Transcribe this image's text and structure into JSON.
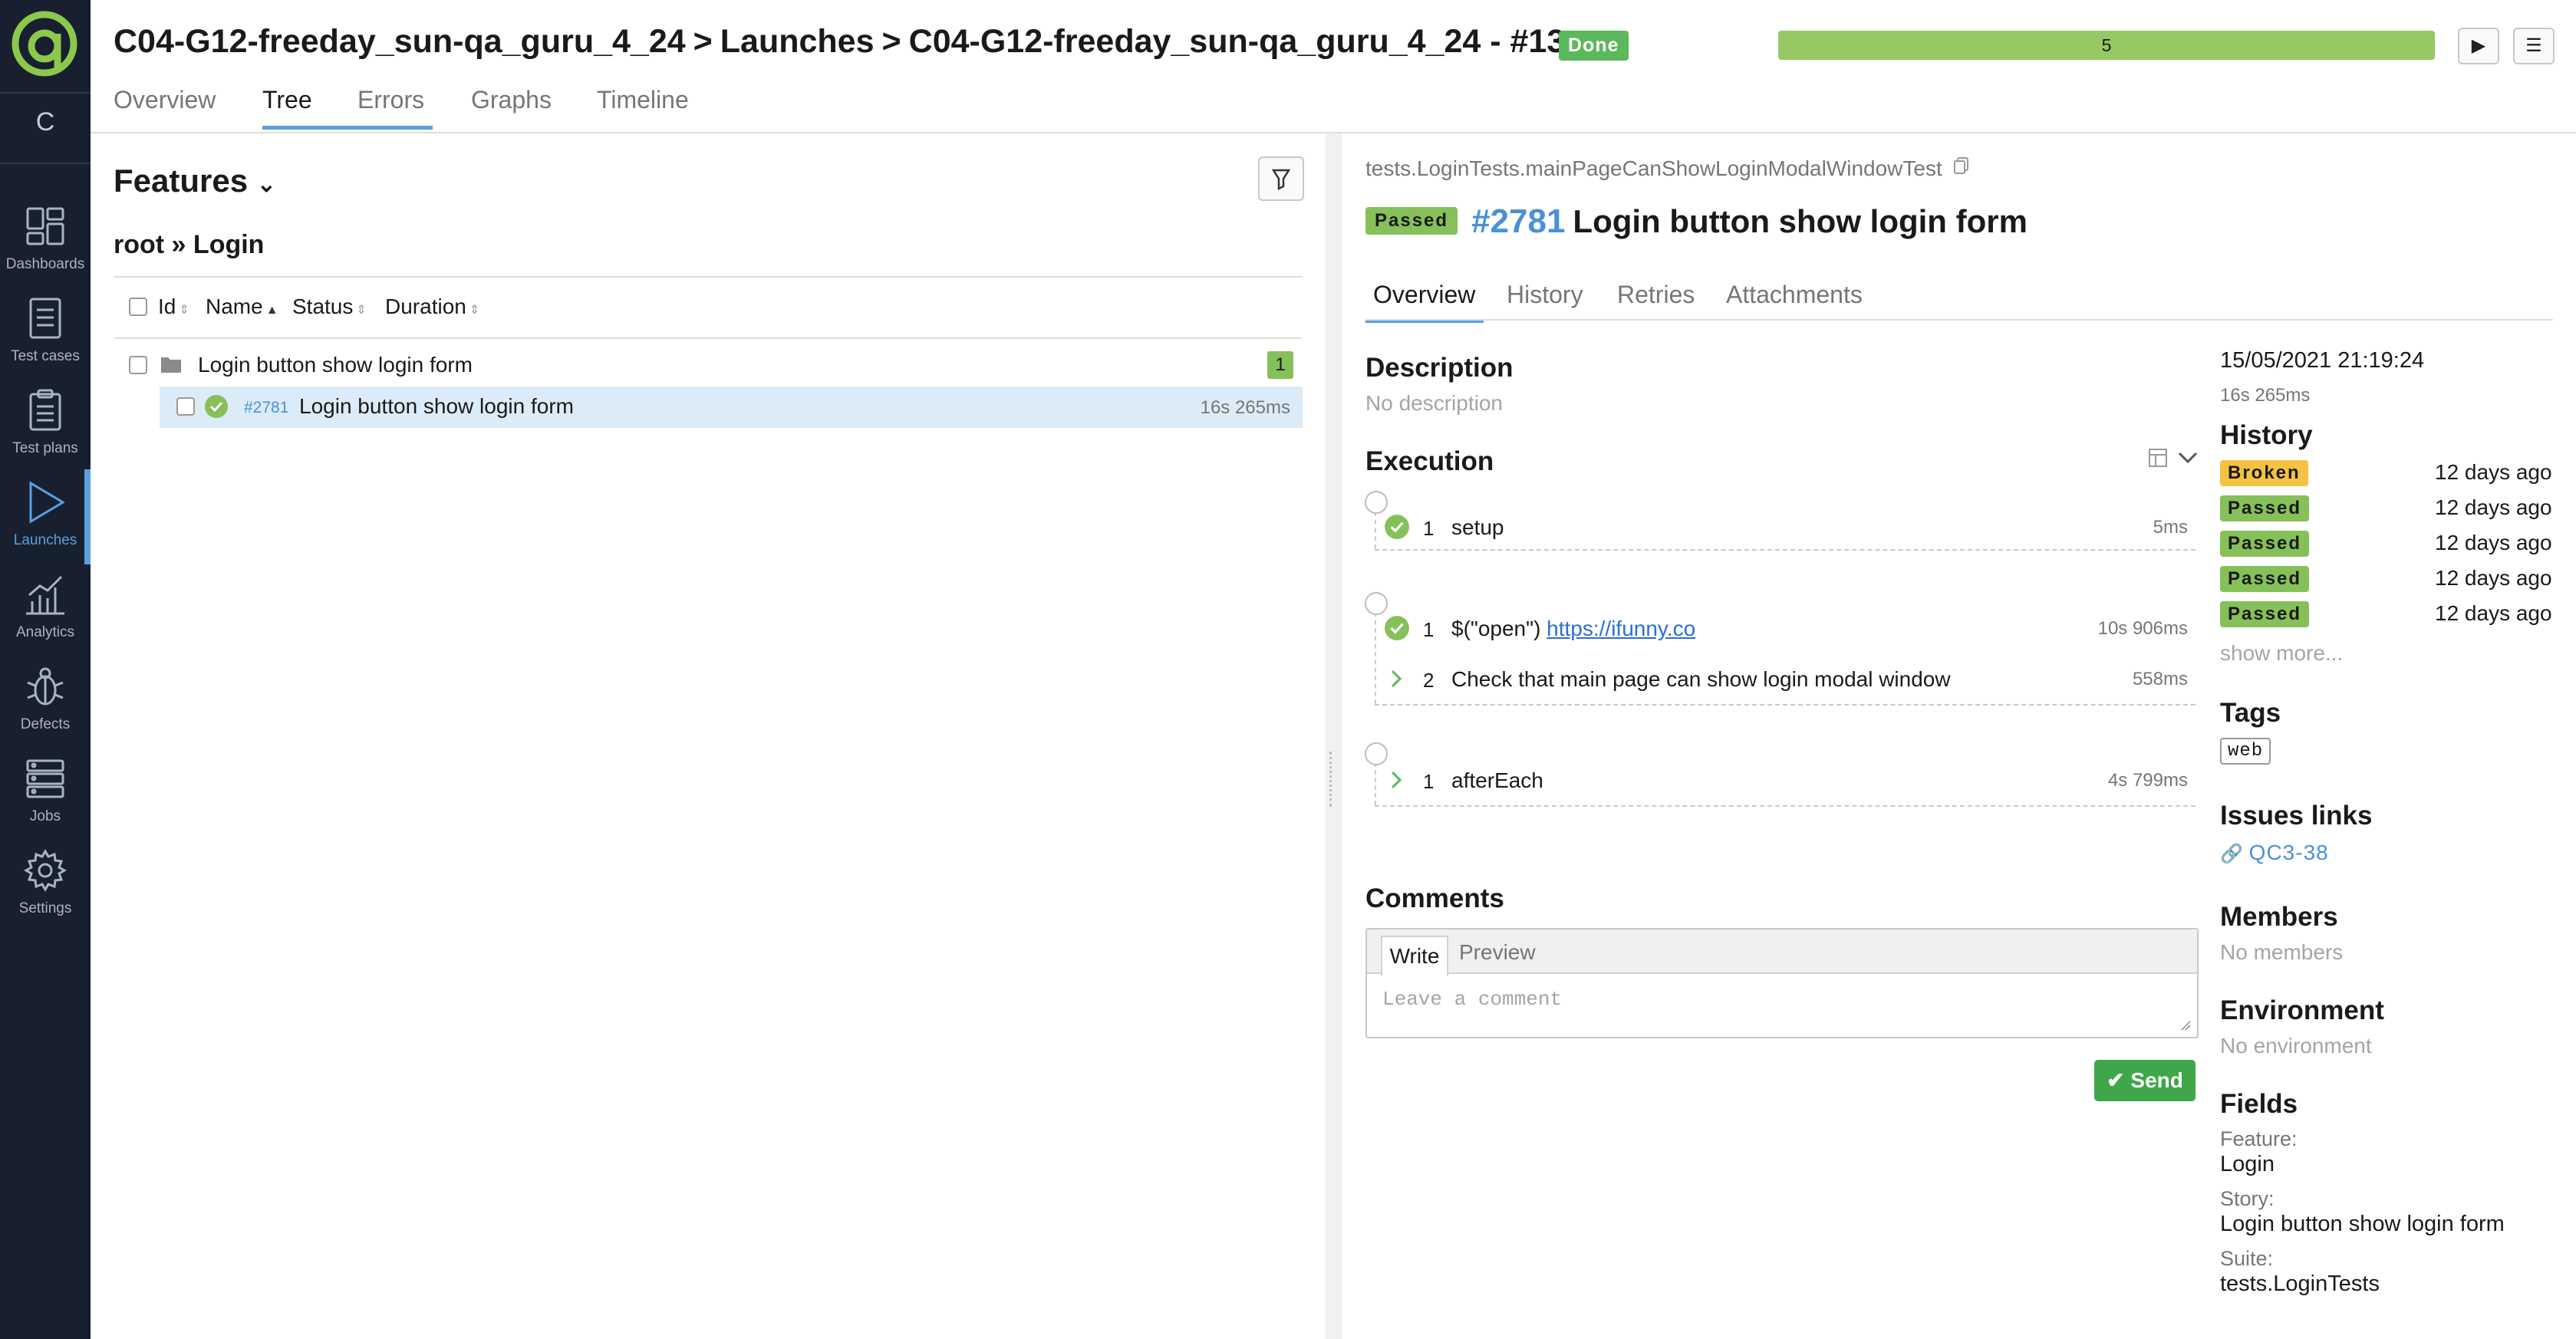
{
  "header": {
    "project_path": "C04-G12-freeday_sun-qa_guru_4_24",
    "launches": "Launches",
    "launch_title": "C04-G12-freeday_sun-qa_guru_4_24 - #13",
    "status_badge": "Done",
    "progress_value": "5",
    "progress_fraction": 1.0,
    "tabs": [
      "Overview",
      "Tree",
      "Errors",
      "Graphs",
      "Timeline"
    ],
    "active_tab": "Tree"
  },
  "sidebar": {
    "project_letter": "C",
    "items": [
      {
        "label": "Dashboards",
        "icon": "dashboards-icon"
      },
      {
        "label": "Test cases",
        "icon": "test-cases-icon"
      },
      {
        "label": "Test plans",
        "icon": "test-plans-icon"
      },
      {
        "label": "Launches",
        "icon": "launches-icon"
      },
      {
        "label": "Analytics",
        "icon": "analytics-icon"
      },
      {
        "label": "Defects",
        "icon": "defects-icon"
      },
      {
        "label": "Jobs",
        "icon": "jobs-icon"
      },
      {
        "label": "Settings",
        "icon": "settings-icon"
      }
    ],
    "active_item": "Launches"
  },
  "tree": {
    "title": "Features",
    "breadcrumb_root": "root",
    "breadcrumb_current": "Login",
    "columns": [
      "Id",
      "Name",
      "Status",
      "Duration"
    ],
    "group": {
      "name": "Login button show login form",
      "count": "1"
    },
    "rows": [
      {
        "id": "#2781",
        "name": "Login button show login form",
        "duration": "16s 265ms",
        "status": "passed"
      }
    ]
  },
  "result": {
    "full_name": "tests.LoginTests.mainPageCanShowLoginModalWindowTest",
    "status": "Passed",
    "id": "#2781",
    "name": "Login button show login form",
    "tabs": [
      "Overview",
      "History",
      "Retries",
      "Attachments"
    ],
    "active_tab": "Overview",
    "description_title": "Description",
    "description": "No description",
    "execution_title": "Execution",
    "setup_steps": [
      {
        "n": "1",
        "text": "setup",
        "duration": "5ms"
      }
    ],
    "body_steps": [
      {
        "n": "1",
        "prefix": "$(\"open\") ",
        "link": "https://ifunny.co",
        "duration": "10s 906ms"
      },
      {
        "n": "2",
        "text": "Check that main page can show login modal window",
        "duration": "558ms"
      }
    ],
    "teardown_steps": [
      {
        "n": "1",
        "text": "afterEach",
        "duration": "4s 799ms"
      }
    ],
    "comments_title": "Comments",
    "comment_write_tab": "Write",
    "comment_preview_tab": "Preview",
    "comment_placeholder": "Leave a comment",
    "send_label": "Send"
  },
  "details": {
    "date": "15/05/2021 21:19:24",
    "duration": "16s 265ms",
    "history_title": "History",
    "history": [
      {
        "status": "Broken",
        "color": "#f5c242",
        "ago": "12 days ago"
      },
      {
        "status": "Passed",
        "color": "#86c059",
        "ago": "12 days ago"
      },
      {
        "status": "Passed",
        "color": "#86c059",
        "ago": "12 days ago"
      },
      {
        "status": "Passed",
        "color": "#86c059",
        "ago": "12 days ago"
      },
      {
        "status": "Passed",
        "color": "#86c059",
        "ago": "12 days ago"
      }
    ],
    "show_more": "show more...",
    "tags_title": "Tags",
    "tags": [
      "web"
    ],
    "issues_title": "Issues links",
    "issue": "QC3-38",
    "members_title": "Members",
    "members": "No members",
    "environment_title": "Environment",
    "environment": "No environment",
    "fields_title": "Fields",
    "fields": [
      {
        "label": "Feature:",
        "value": "Login"
      },
      {
        "label": "Story:",
        "value": "Login button show login form"
      },
      {
        "label": "Suite:",
        "value": "tests.LoginTests"
      }
    ]
  },
  "colors": {
    "sidebar_bg": "#182030",
    "accent": "#5aa0e0",
    "passed": "#86c059",
    "broken": "#f5c242",
    "logo": "#8cc84b"
  }
}
